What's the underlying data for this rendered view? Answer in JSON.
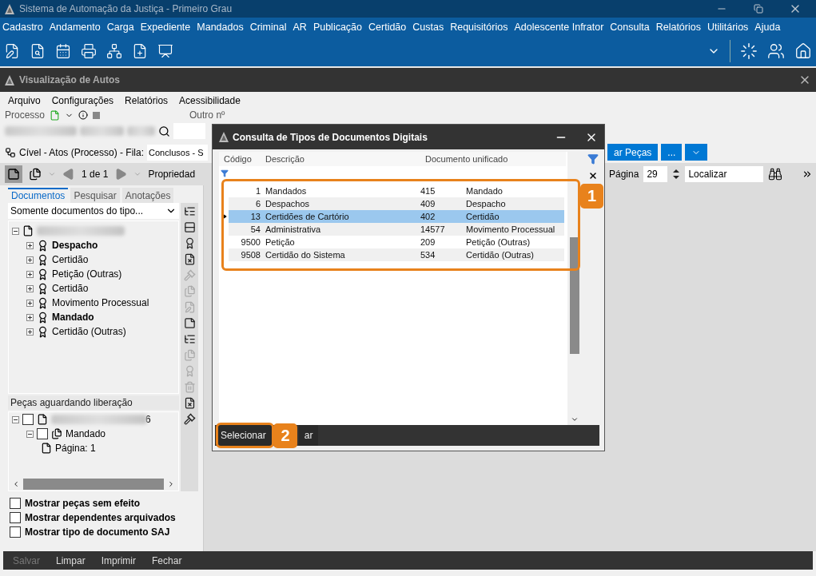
{
  "app": {
    "title": "Sistema de Automação da Justiça - Primeiro Grau",
    "menu": [
      "Cadastro",
      "Andamento",
      "Carga",
      "Expediente",
      "Mandados",
      "Criminal",
      "AR",
      "Publicação",
      "Certidão",
      "Custas",
      "Requisitórios",
      "Adolescente Infrator",
      "Consulta",
      "Relatórios",
      "Utilitários",
      "Ajuda"
    ]
  },
  "window": {
    "title": "Visualização de Autos",
    "menu": [
      "Arquivo",
      "Configurações",
      "Relatórios",
      "Acessibilidade"
    ]
  },
  "process": {
    "label": "Processo",
    "other_label": "Outro nº"
  },
  "queue": {
    "text": "Cível - Atos (Processo) - Fila:",
    "value": "Conclusos - S",
    "buttons": [
      "ar Peças",
      "..."
    ]
  },
  "nav": {
    "pages": "1 de 1",
    "properties": "Propriedad",
    "page_label": "Página",
    "page_value": "29",
    "find_value": "Localizar"
  },
  "tabs": [
    {
      "label": "Documentos",
      "selected": true
    },
    {
      "label": "Pesquisar",
      "selected": false
    },
    {
      "label": "Anotações",
      "selected": false
    }
  ],
  "filter": {
    "value": "Somente documentos do tipo..."
  },
  "tree": {
    "expanded": true,
    "children": [
      {
        "label": "Despacho",
        "bold": true,
        "expanded": false
      },
      {
        "label": "Certidão",
        "bold": false,
        "expanded": false
      },
      {
        "label": "Petição (Outras)",
        "bold": false,
        "expanded": false
      },
      {
        "label": "Certidão",
        "bold": false,
        "expanded": false
      },
      {
        "label": "Movimento Processual",
        "bold": false,
        "expanded": false
      },
      {
        "label": "Mandado",
        "bold": true,
        "expanded": false
      },
      {
        "label": "Certidão (Outras)",
        "bold": false,
        "expanded": false
      }
    ]
  },
  "pending": {
    "title": "Peças aguardando liberação",
    "root": {
      "suffix": "6",
      "checked": false,
      "expanded": true,
      "children": [
        {
          "label": "Mandado",
          "checked": false,
          "expanded": true,
          "children": [
            {
              "label": "Página: 1"
            }
          ]
        }
      ]
    }
  },
  "options": [
    {
      "label": "Mostrar peças sem efeito",
      "checked": false
    },
    {
      "label": "Mostrar dependentes arquivados",
      "checked": false
    },
    {
      "label": "Mostrar tipo de documento SAJ",
      "checked": false
    }
  ],
  "footer": [
    {
      "label": "Salvar",
      "disabled": true
    },
    {
      "label": "Limpar",
      "disabled": false
    },
    {
      "label": "Imprimir",
      "disabled": false
    },
    {
      "label": "Fechar",
      "disabled": false
    }
  ],
  "dialog": {
    "title": "Consulta de Tipos de Documentos Digitais",
    "columns": [
      "Código",
      "Descrição",
      "Documento unificado"
    ],
    "rows": [
      {
        "code": "1",
        "description": "Mandados",
        "doc_code": "415",
        "doc_name": "Mandado",
        "selected": false
      },
      {
        "code": "6",
        "description": "Despachos",
        "doc_code": "409",
        "doc_name": "Despacho",
        "selected": false
      },
      {
        "code": "13",
        "description": "Certidões de Cartório",
        "doc_code": "402",
        "doc_name": "Certidão",
        "selected": true
      },
      {
        "code": "54",
        "description": "Administrativa",
        "doc_code": "14577",
        "doc_name": "Movimento Processual",
        "selected": false
      },
      {
        "code": "9500",
        "description": "Petição",
        "doc_code": "209",
        "doc_name": "Petição (Outras)",
        "selected": false
      },
      {
        "code": "9508",
        "description": "Certidão do Sistema",
        "doc_code": "534",
        "doc_name": "Certidão (Outras)",
        "selected": false
      }
    ],
    "buttons": [
      "Selecionar",
      "ar"
    ],
    "callouts": [
      "1",
      "2"
    ]
  }
}
